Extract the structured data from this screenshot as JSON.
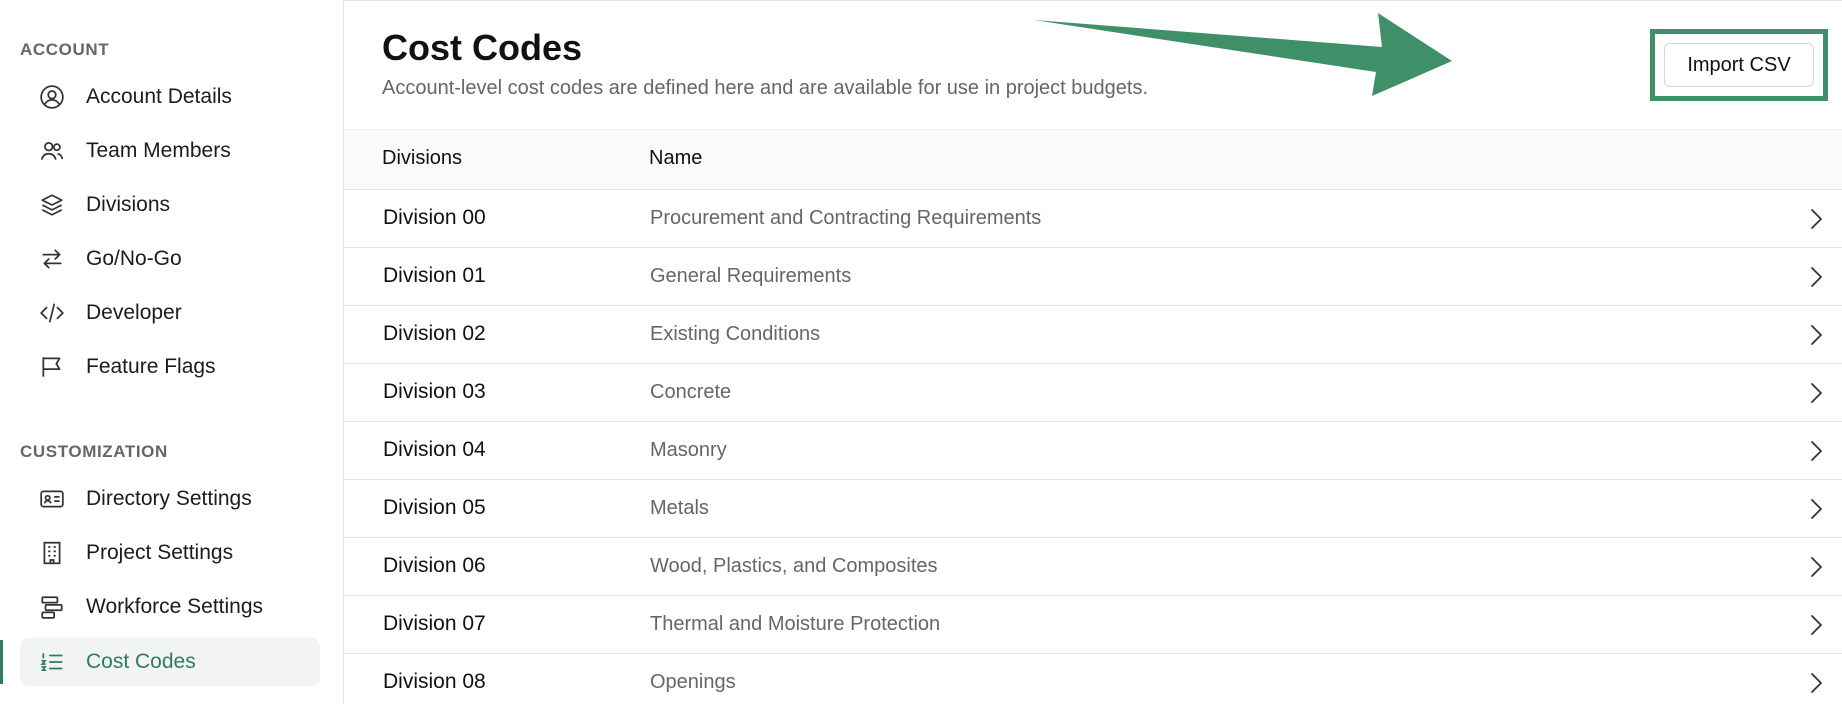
{
  "sidebar": {
    "sections": [
      {
        "heading": "ACCOUNT",
        "items": [
          {
            "label": "Account Details",
            "icon": "user-circle-icon"
          },
          {
            "label": "Team Members",
            "icon": "users-icon"
          },
          {
            "label": "Divisions",
            "icon": "layers-icon"
          },
          {
            "label": "Go/No-Go",
            "icon": "arrows-swap-icon"
          },
          {
            "label": "Developer",
            "icon": "code-icon"
          },
          {
            "label": "Feature Flags",
            "icon": "flag-icon"
          }
        ]
      },
      {
        "heading": "CUSTOMIZATION",
        "items": [
          {
            "label": "Directory Settings",
            "icon": "id-card-icon"
          },
          {
            "label": "Project Settings",
            "icon": "building-icon"
          },
          {
            "label": "Workforce Settings",
            "icon": "workforce-icon"
          },
          {
            "label": "Cost Codes",
            "icon": "numbered-list-icon",
            "active": true
          }
        ]
      }
    ]
  },
  "header": {
    "title": "Cost Codes",
    "subtitle": "Account-level cost codes are defined here and are available for use in project budgets.",
    "import_label": "Import CSV"
  },
  "table": {
    "columns": [
      "Divisions",
      "Name"
    ],
    "rows": [
      {
        "division": "Division 00",
        "name": "Procurement and Contracting Requirements"
      },
      {
        "division": "Division 01",
        "name": "General Requirements"
      },
      {
        "division": "Division 02",
        "name": "Existing Conditions"
      },
      {
        "division": "Division 03",
        "name": "Concrete"
      },
      {
        "division": "Division 04",
        "name": "Masonry"
      },
      {
        "division": "Division 05",
        "name": "Metals"
      },
      {
        "division": "Division 06",
        "name": "Wood, Plastics, and Composites"
      },
      {
        "division": "Division 07",
        "name": "Thermal and Moisture Protection"
      },
      {
        "division": "Division 08",
        "name": "Openings"
      }
    ]
  },
  "colors": {
    "accent": "#2f7d5a",
    "annotation": "#3f8f68"
  }
}
